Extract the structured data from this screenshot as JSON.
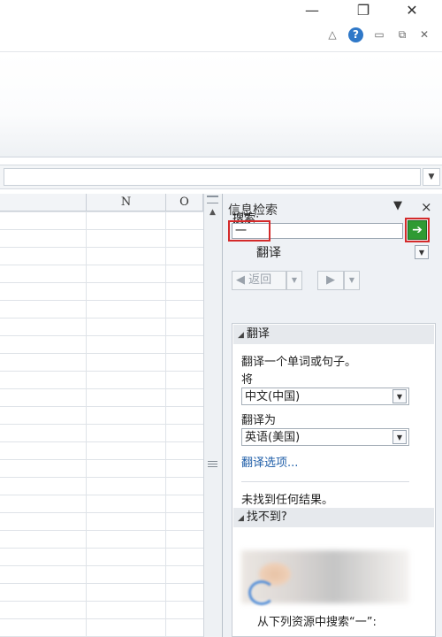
{
  "window": {
    "minimize_glyph": "—",
    "restore_glyph": "❐",
    "close_glyph": "✕"
  },
  "ribbon_controls": {
    "collapse_glyph": "△",
    "help_glyph": "?",
    "minimize_glyph": "▭",
    "restore_glyph": "⧉",
    "close_glyph": "✕"
  },
  "formula_bar": {
    "expand_glyph": "▼"
  },
  "sheet": {
    "columns": [
      "",
      "N",
      "O"
    ]
  },
  "research_pane": {
    "title": "信息检索",
    "dropdown_glyph": "▼",
    "close_glyph": "×",
    "search_label": "搜索:",
    "search_value": "一",
    "go_glyph": "➔",
    "source_value": "翻译",
    "back_label": "返回",
    "translate_section": {
      "header": "翻译",
      "instruction": "翻译一个单词或句子。",
      "from_label": "将",
      "from_value": "中文(中国)",
      "to_label": "翻译为",
      "to_value": "英语(美国)",
      "options_link": "翻译选项..."
    },
    "no_result": "未找到任何结果。",
    "not_found_section": {
      "header": "找不到?",
      "search_sources": "从下列资源中搜索“一”:"
    }
  }
}
